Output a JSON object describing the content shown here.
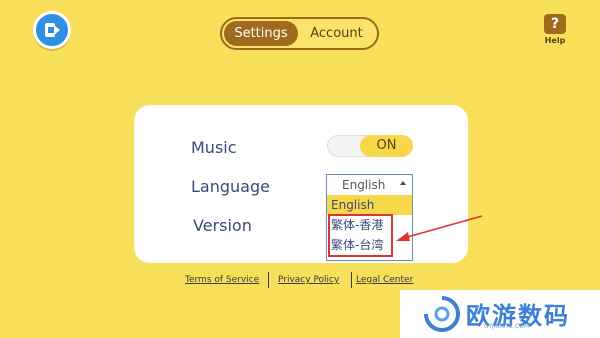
{
  "tabs": [
    {
      "label": "Settings",
      "active": true
    },
    {
      "label": "Account",
      "active": false
    }
  ],
  "help": {
    "label": "Help",
    "glyph": "?"
  },
  "settings": {
    "music_label": "Music",
    "music_toggle": "ON",
    "language_label": "Language",
    "language_current": "English",
    "language_options": [
      "English",
      "繁体-香港",
      "繁体-台湾"
    ],
    "version_label": "Version"
  },
  "footer": {
    "terms": "Terms of Service",
    "privacy": "Privacy Policy",
    "legal": "Legal Center"
  },
  "watermark": {
    "name": "欧游数码",
    "url": "OYJK0572.COM"
  },
  "colors": {
    "background": "#f9e05a",
    "accent": "#a06a1c",
    "highlight": "#f7d84a",
    "annotation": "#dd3333"
  }
}
